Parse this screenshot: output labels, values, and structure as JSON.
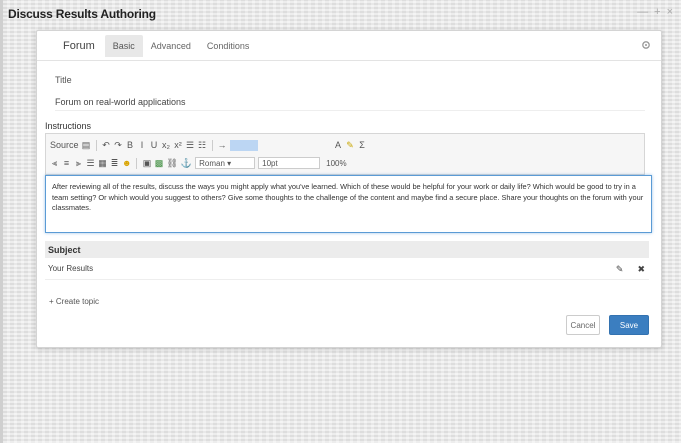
{
  "window": {
    "title": "Discuss Results Authoring",
    "controls": [
      "—",
      "+",
      "×"
    ]
  },
  "tabs": {
    "forum": "Forum",
    "basic": "Basic",
    "advanced": "Advanced",
    "conditions": "Conditions",
    "settings_icon": "gear-icon"
  },
  "form": {
    "title_label": "Title",
    "title_value": "Forum on real-world applications",
    "instructions_label": "Instructions",
    "editor_text": "After reviewing all of the results, discuss the ways you might apply what you've learned. Which of these would be helpful for your work or daily life? Which would be good to try in a team setting? Or which would you suggest to others? Give some thoughts to the challenge of the content and maybe find a secure place. Share your thoughts on the forum with your classmates."
  },
  "toolbar": {
    "source_label": "Source",
    "font_select": "Roman ▾",
    "size_select": "10pt",
    "zoom": "100%"
  },
  "subject": {
    "header": "Subject",
    "topics": [
      {
        "title": "Your Results"
      }
    ],
    "add_topic": "+ Create topic"
  },
  "actions": {
    "cancel": "Cancel",
    "save": "Save"
  },
  "colors": {
    "accent": "#3b7ec0",
    "editor_focus": "#5b9bd5",
    "subject_bg": "#ececec"
  }
}
